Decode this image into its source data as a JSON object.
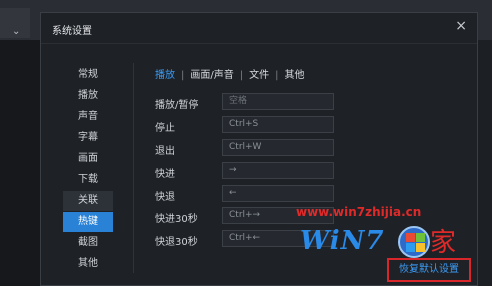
{
  "dialog": {
    "title": "系统设置",
    "close_label": "×"
  },
  "background": {
    "chevron": "⌄"
  },
  "nav": {
    "items": [
      {
        "label": "常规",
        "state": "normal"
      },
      {
        "label": "播放",
        "state": "normal"
      },
      {
        "label": "声音",
        "state": "normal"
      },
      {
        "label": "字幕",
        "state": "normal"
      },
      {
        "label": "画面",
        "state": "normal"
      },
      {
        "label": "下载",
        "state": "normal"
      },
      {
        "label": "关联",
        "state": "hover"
      },
      {
        "label": "热键",
        "state": "active"
      },
      {
        "label": "截图",
        "state": "normal"
      },
      {
        "label": "其他",
        "state": "normal"
      }
    ]
  },
  "tabs": {
    "items": [
      {
        "label": "播放",
        "active": true
      },
      {
        "label": "画面/声音",
        "active": false
      },
      {
        "label": "文件",
        "active": false
      },
      {
        "label": "其他",
        "active": false
      }
    ],
    "separator": "|"
  },
  "hotkeys": [
    {
      "label": "播放/暂停",
      "value": "空格"
    },
    {
      "label": "停止",
      "value": "Ctrl+S"
    },
    {
      "label": "退出",
      "value": "Ctrl+W"
    },
    {
      "label": "快进",
      "value": "→"
    },
    {
      "label": "快退",
      "value": "←"
    },
    {
      "label": "快进30秒",
      "value": "Ctrl+→"
    },
    {
      "label": "快退30秒",
      "value": "Ctrl+←"
    }
  ],
  "watermark": {
    "url": "www.win7zhijia.cn",
    "logo": "WiN7",
    "char": "家"
  },
  "restore_button": {
    "label": "恢复默认设置"
  },
  "colors": {
    "accent": "#2a82d6",
    "tab_active": "#3c9cf5",
    "highlight_border": "#d8262b"
  }
}
